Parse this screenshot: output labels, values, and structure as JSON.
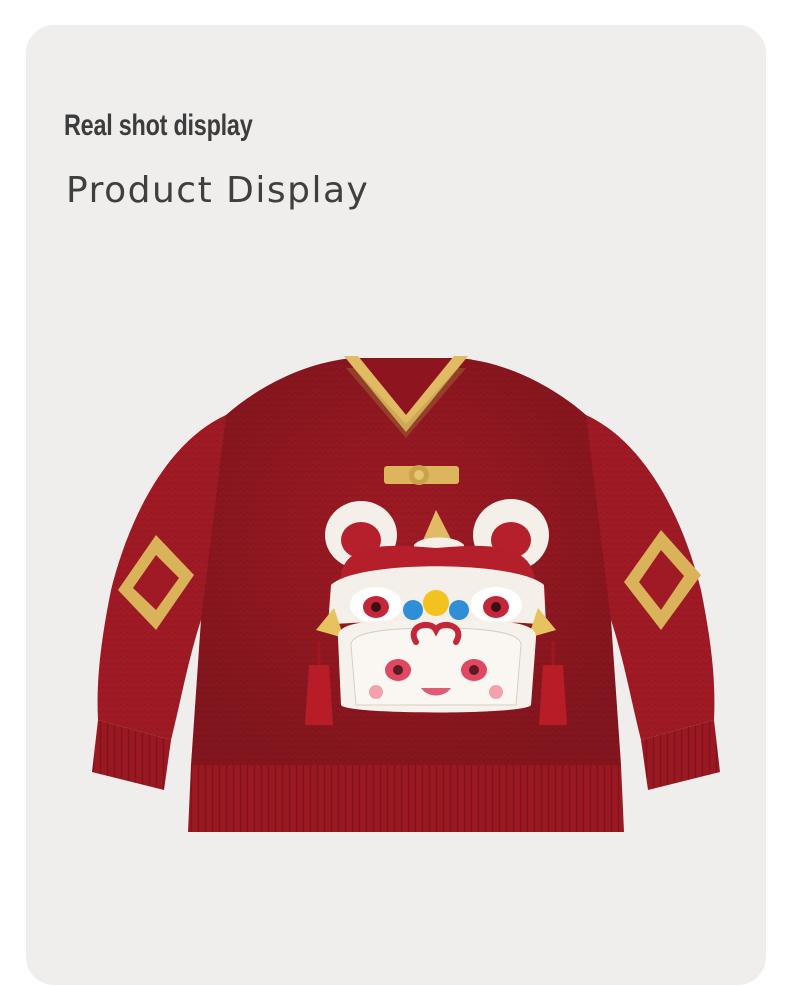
{
  "header": {
    "title": "Real shot display",
    "subtitle": "Product Display"
  },
  "product_image": {
    "subject": "red-knit-lion-dance-sweater-icon"
  },
  "colors": {
    "page_background": "#ffffff",
    "card_background": "#efeeed",
    "sweater_red": "#a11a24",
    "collar_gold": "#e0bb63",
    "fleece_white": "#f5f0ea"
  }
}
